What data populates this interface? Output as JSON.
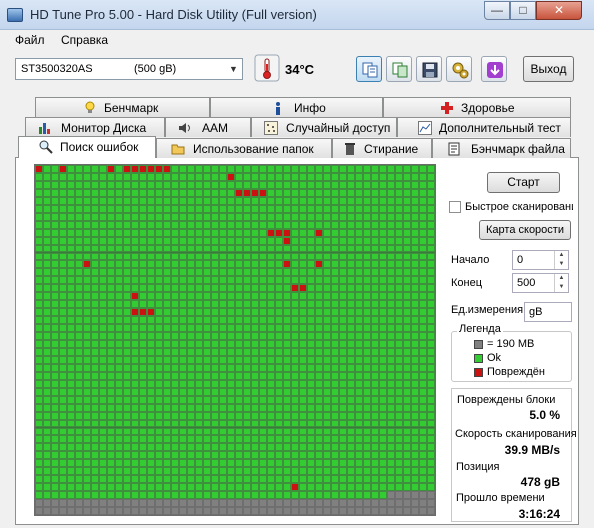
{
  "window": {
    "title": "HD Tune Pro 5.00 - Hard Disk Utility (Full  version)",
    "minimize": "—",
    "maximize": "□",
    "close": "✕"
  },
  "menu": [
    {
      "label": "Файл"
    },
    {
      "label": "Справка"
    }
  ],
  "toolbar": {
    "drive_name": "ST3500320AS",
    "drive_size": "(500 gB)",
    "temperature": "34°C",
    "exit_label": "Выход",
    "icons": [
      "copy-info-icon",
      "copy-screenshot-icon",
      "save-icon",
      "options-icon",
      "download-icon"
    ]
  },
  "tabs": {
    "row1": [
      {
        "label": "Бенчмарк",
        "icon": "lightbulb-icon"
      },
      {
        "label": "Инфо",
        "icon": "info-icon"
      },
      {
        "label": "Здоровье",
        "icon": "health-cross-icon"
      }
    ],
    "row2": [
      {
        "label": "Монитор Диска",
        "icon": "bar-chart-icon"
      },
      {
        "label": "AAM",
        "icon": "speaker-icon"
      },
      {
        "label": "Случайный доступ",
        "icon": "dots-icon"
      },
      {
        "label": "Дополнительный  тест",
        "icon": "chart-icon"
      }
    ],
    "row3": [
      {
        "label": "Поиск ошибок",
        "icon": "magnifier-icon",
        "selected": true
      },
      {
        "label": "Использование папок",
        "icon": "folder-icon"
      },
      {
        "label": "Стирание",
        "icon": "trash-icon"
      },
      {
        "label": "Бэнчмарк файла",
        "icon": "file-benchmark-icon"
      }
    ]
  },
  "controls": {
    "start_label": "Старт",
    "quick_scan_label": "Быстрое сканирование",
    "quick_scan_checked": false,
    "speed_map_label": "Карта скорости",
    "start_field_label": "Начало",
    "start_value": "0",
    "end_field_label": "Конец",
    "end_value": "500",
    "unit_label": "Ед.измерения",
    "unit_value": "gB"
  },
  "legend": {
    "title": "Легенда",
    "items": [
      {
        "label": "= 190 MB",
        "color": "#808080"
      },
      {
        "label": "Ok",
        "color": "#33cc33"
      },
      {
        "label": "Повреждён",
        "color": "#cc1111"
      }
    ]
  },
  "stats": {
    "damaged_label": "Повреждены блоки",
    "damaged_value": "5.0 %",
    "speed_label": "Скорость сканирования",
    "speed_value": "39.9 MB/s",
    "position_label": "Позиция",
    "position_value": "478 gB",
    "elapsed_label": "Прошло времени",
    "elapsed_value": "3:16:24"
  },
  "scan_map": {
    "columns": 50,
    "rows": 44,
    "colors": {
      "ok": "#33cc33",
      "damaged": "#cc1111",
      "unscanned": "#808080"
    },
    "damaged_blocks": [
      [
        0,
        0
      ],
      [
        0,
        3
      ],
      [
        0,
        9
      ],
      [
        0,
        11
      ],
      [
        0,
        12
      ],
      [
        0,
        13
      ],
      [
        0,
        14
      ],
      [
        0,
        15
      ],
      [
        0,
        16
      ],
      [
        1,
        24
      ],
      [
        3,
        25
      ],
      [
        3,
        26
      ],
      [
        3,
        27
      ],
      [
        3,
        28
      ],
      [
        8,
        29
      ],
      [
        8,
        30
      ],
      [
        8,
        31
      ],
      [
        8,
        35
      ],
      [
        9,
        31
      ],
      [
        12,
        6
      ],
      [
        12,
        31
      ],
      [
        12,
        35
      ],
      [
        15,
        32
      ],
      [
        15,
        33
      ],
      [
        16,
        12
      ],
      [
        18,
        12
      ],
      [
        18,
        13
      ],
      [
        18,
        14
      ],
      [
        40,
        32
      ]
    ],
    "unscanned_from": {
      "row": 41,
      "col": 44
    }
  }
}
